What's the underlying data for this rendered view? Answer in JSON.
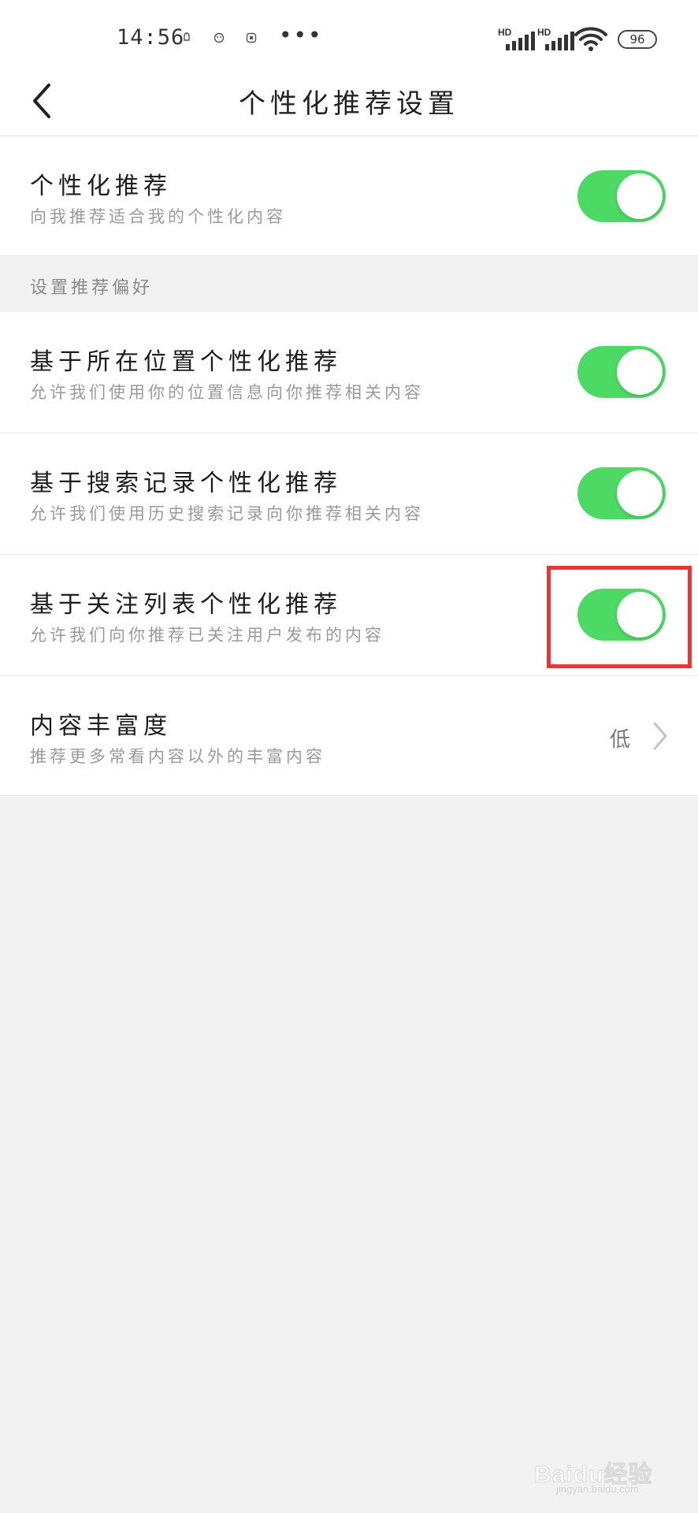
{
  "status_bar": {
    "time": "14:56",
    "more_indicator": "•••",
    "battery": "96",
    "signal_label": "HD",
    "icons": [
      "notification-icon",
      "notification-icon",
      "notification-icon",
      "signal-icon",
      "signal-icon",
      "wifi-icon",
      "battery-icon"
    ]
  },
  "nav": {
    "title": "个性化推荐设置",
    "back_icon": "chevron-left-icon"
  },
  "personal": {
    "title": "个性化推荐",
    "subtitle": "向我推荐适合我的个性化内容",
    "enabled": true
  },
  "section": {
    "label": "设置推荐偏好"
  },
  "preferences": [
    {
      "title": "基于所在位置个性化推荐",
      "subtitle": "允许我们使用你的位置信息向你推荐相关内容",
      "enabled": true
    },
    {
      "title": "基于搜索记录个性化推荐",
      "subtitle": "允许我们使用历史搜索记录向你推荐相关内容",
      "enabled": true
    },
    {
      "title": "基于关注列表个性化推荐",
      "subtitle": "允许我们向你推荐已关注用户发布的内容",
      "enabled": true
    }
  ],
  "richness": {
    "title": "内容丰富度",
    "subtitle": "推荐更多常看内容以外的丰富内容",
    "value": "低",
    "chevron_icon": "chevron-right-icon"
  },
  "watermark": {
    "text": "Baidu经验",
    "url": "jingyan.baidu.com"
  },
  "colors": {
    "toggle_on": "#4cd964",
    "highlight": "#e83535",
    "background": "#f1f1f1"
  }
}
